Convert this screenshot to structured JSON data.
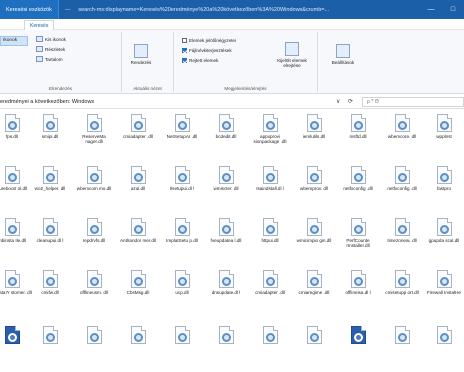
{
  "window": {
    "title_tab": "Keresési eszközök",
    "title_sep": "—",
    "path": "search-ms:displayname=Keresés%20eredménye%20a%20következőben%3A%20Windows&crumb=...",
    "minimize": "—",
    "maximize": "□"
  },
  "ribbon_tabs": {
    "active": "Keresés"
  },
  "ribbon": {
    "selected_strip": "Ikonok",
    "layout_items": [
      "Kis ikonok",
      "Részletek",
      "Tartalom"
    ],
    "group_layout": "Elrendezés",
    "sort_label": "Rendezés",
    "group_current_view": "Aktuális nézet",
    "checkboxes": [
      {
        "label": "Elemek jelölőnégyzetei",
        "checked": false
      },
      {
        "label": "Fájlnévkiterjesztések",
        "checked": true
      },
      {
        "label": "Rejtett elemek",
        "checked": true
      }
    ],
    "hide_selected": "Kijelölt elemek elrejtése",
    "group_show_hide": "Megjelenítés/elrejtés",
    "options": "Beállítások"
  },
  "address": {
    "text": "eredményei a következőben: Windows",
    "dropdown": "∨",
    "refresh": "⟳",
    "search_value": "ρ  *˙Θ"
  },
  "files": [
    [
      "fps.dll",
      "smipi.dll",
      "ReserveMa nager.dll",
      "cmiadapter .dll",
      "NetSetupAI .dll",
      "bcdedit.dll",
      "appxprovi sionpackage .dll",
      "iemlutils.dll",
      "msftd.dll",
      "wbemcore. dll",
      "wpplnst"
    ],
    [
      "surebootr ol.dll",
      "wo2_helper. dll",
      "wbemcom mo.dll",
      "azul.dll",
      "Ilsetupui.dl l",
      "wmiscter. dll",
      "Isaindstall.dl l",
      "wbemprov. dll",
      "netfxconfig .dll",
      "netfxconfig .dll",
      "fastpro"
    ],
    [
      "mbinsta Ile.dll",
      "cleanupui.dl l",
      "repdrvfs.dll",
      "Antlrandor mer.dll",
      "ImplatSetu p.dll",
      "fveupdatea l.dll",
      "httpui.dll",
      "wmicimpio gin.dll",
      "PerfCounte rInstaller.dll",
      "timezoneai. dll",
      "gpupda scal.dll"
    ],
    [
      "inData7r stomer. dll",
      "cmifw.dll",
      "offlineusm. dll",
      "CbsMsg.dll",
      "ucp.dll",
      "dnsupdate.dl l",
      "cmiadapter .dll",
      "cmiaregime .dll",
      "offlineisa.dl l",
      "cmisetupp ort.dll",
      "Firewall InstalHe"
    ],
    [
      "",
      "",
      "",
      "",
      "",
      "",
      "",
      "",
      "",
      "",
      ""
    ]
  ]
}
